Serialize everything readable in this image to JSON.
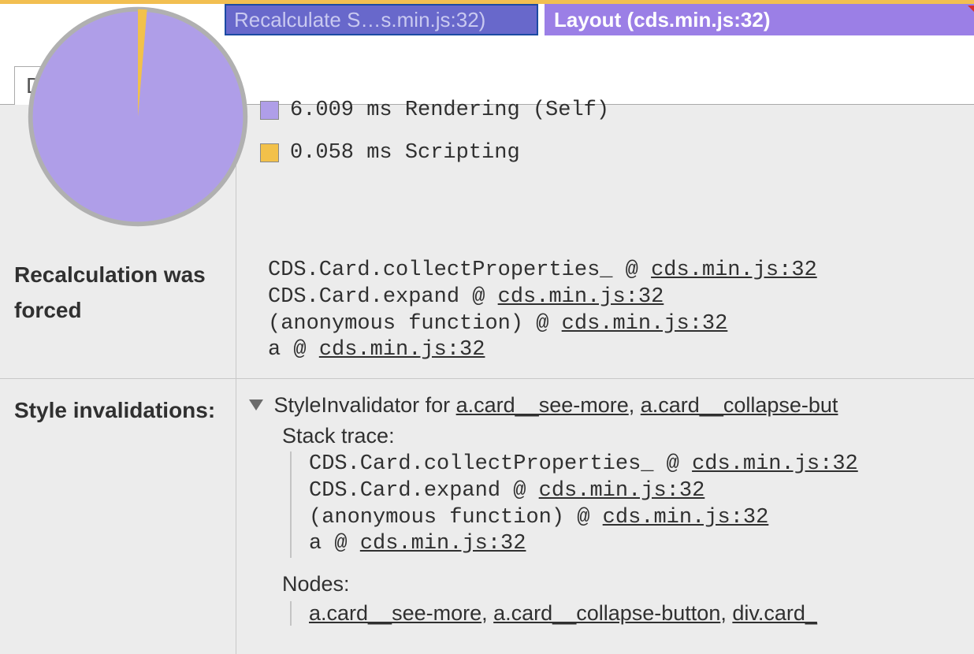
{
  "chart_data": {
    "type": "pie",
    "title": "",
    "series": [
      {
        "name": "Rendering (Self)",
        "value": 6.009,
        "unit": "ms",
        "color": "#af9ee8"
      },
      {
        "name": "Scripting",
        "value": 0.058,
        "unit": "ms",
        "color": "#f2c14a"
      }
    ]
  },
  "flame": {
    "selected_label": "Recalculate S…s.min.js:32)",
    "layout_label": "Layout (cds.min.js:32)"
  },
  "tabs": {
    "details": "Details"
  },
  "legend": {
    "rendering": "6.009 ms Rendering (Self)",
    "scripting": "0.058 ms Scripting"
  },
  "rows": {
    "recalc_forced_label": "Recalculation was forced",
    "style_invalidations_label": "Style invalidations:"
  },
  "stack1": {
    "l0_fn": "CDS.Card.collectProperties_",
    "l0_at": " @ ",
    "l0_link": "cds.min.js:32",
    "l1_fn": "CDS.Card.expand",
    "l1_at": " @ ",
    "l1_link": "cds.min.js:32",
    "l2_fn": "(anonymous function)",
    "l2_at": " @ ",
    "l2_link": "cds.min.js:32",
    "l3_fn": "a",
    "l3_at": " @ ",
    "l3_link": "cds.min.js:32"
  },
  "invalidator": {
    "heading_prefix": "StyleInvalidator for ",
    "node0": "a.card__see-more",
    "sep": ", ",
    "node1": "a.card__collapse-but",
    "stack_trace_label": "Stack trace",
    "colon": ":",
    "nodes_label": "Nodes",
    "nodes": {
      "n0": "a.card__see-more",
      "n1": "a.card__collapse-button",
      "n2": "div.card_"
    }
  },
  "stack2": {
    "l0_fn": "CDS.Card.collectProperties_",
    "l0_at": " @ ",
    "l0_link": "cds.min.js:32",
    "l1_fn": "CDS.Card.expand",
    "l1_at": " @ ",
    "l1_link": "cds.min.js:32",
    "l2_fn": "(anonymous function)",
    "l2_at": " @ ",
    "l2_link": "cds.min.js:32",
    "l3_fn": "a",
    "l3_at": " @ ",
    "l3_link": "cds.min.js:32"
  }
}
